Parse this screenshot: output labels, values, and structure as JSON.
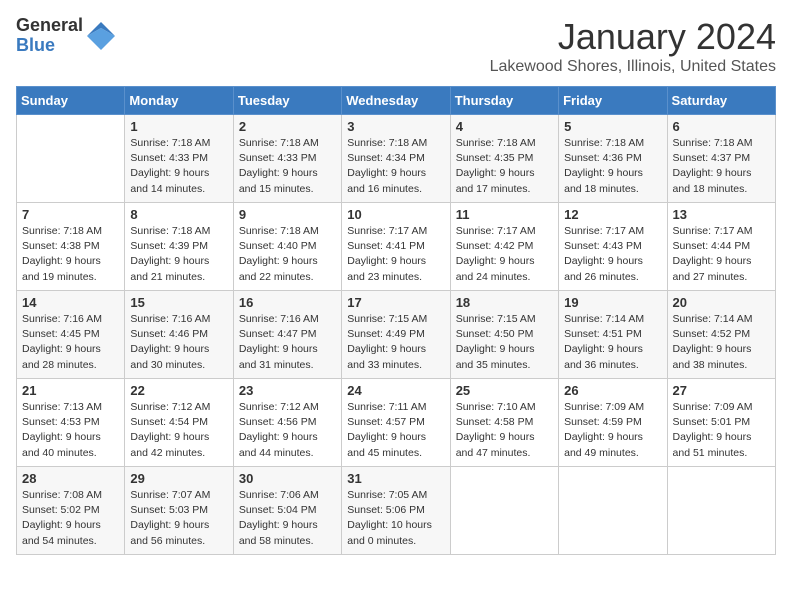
{
  "logo": {
    "general": "General",
    "blue": "Blue"
  },
  "header": {
    "month": "January 2024",
    "location": "Lakewood Shores, Illinois, United States"
  },
  "weekdays": [
    "Sunday",
    "Monday",
    "Tuesday",
    "Wednesday",
    "Thursday",
    "Friday",
    "Saturday"
  ],
  "weeks": [
    [
      {
        "day": "",
        "sunrise": "",
        "sunset": "",
        "daylight": ""
      },
      {
        "day": "1",
        "sunrise": "Sunrise: 7:18 AM",
        "sunset": "Sunset: 4:33 PM",
        "daylight": "Daylight: 9 hours and 14 minutes."
      },
      {
        "day": "2",
        "sunrise": "Sunrise: 7:18 AM",
        "sunset": "Sunset: 4:33 PM",
        "daylight": "Daylight: 9 hours and 15 minutes."
      },
      {
        "day": "3",
        "sunrise": "Sunrise: 7:18 AM",
        "sunset": "Sunset: 4:34 PM",
        "daylight": "Daylight: 9 hours and 16 minutes."
      },
      {
        "day": "4",
        "sunrise": "Sunrise: 7:18 AM",
        "sunset": "Sunset: 4:35 PM",
        "daylight": "Daylight: 9 hours and 17 minutes."
      },
      {
        "day": "5",
        "sunrise": "Sunrise: 7:18 AM",
        "sunset": "Sunset: 4:36 PM",
        "daylight": "Daylight: 9 hours and 18 minutes."
      },
      {
        "day": "6",
        "sunrise": "Sunrise: 7:18 AM",
        "sunset": "Sunset: 4:37 PM",
        "daylight": "Daylight: 9 hours and 18 minutes."
      }
    ],
    [
      {
        "day": "7",
        "sunrise": "Sunrise: 7:18 AM",
        "sunset": "Sunset: 4:38 PM",
        "daylight": "Daylight: 9 hours and 19 minutes."
      },
      {
        "day": "8",
        "sunrise": "Sunrise: 7:18 AM",
        "sunset": "Sunset: 4:39 PM",
        "daylight": "Daylight: 9 hours and 21 minutes."
      },
      {
        "day": "9",
        "sunrise": "Sunrise: 7:18 AM",
        "sunset": "Sunset: 4:40 PM",
        "daylight": "Daylight: 9 hours and 22 minutes."
      },
      {
        "day": "10",
        "sunrise": "Sunrise: 7:17 AM",
        "sunset": "Sunset: 4:41 PM",
        "daylight": "Daylight: 9 hours and 23 minutes."
      },
      {
        "day": "11",
        "sunrise": "Sunrise: 7:17 AM",
        "sunset": "Sunset: 4:42 PM",
        "daylight": "Daylight: 9 hours and 24 minutes."
      },
      {
        "day": "12",
        "sunrise": "Sunrise: 7:17 AM",
        "sunset": "Sunset: 4:43 PM",
        "daylight": "Daylight: 9 hours and 26 minutes."
      },
      {
        "day": "13",
        "sunrise": "Sunrise: 7:17 AM",
        "sunset": "Sunset: 4:44 PM",
        "daylight": "Daylight: 9 hours and 27 minutes."
      }
    ],
    [
      {
        "day": "14",
        "sunrise": "Sunrise: 7:16 AM",
        "sunset": "Sunset: 4:45 PM",
        "daylight": "Daylight: 9 hours and 28 minutes."
      },
      {
        "day": "15",
        "sunrise": "Sunrise: 7:16 AM",
        "sunset": "Sunset: 4:46 PM",
        "daylight": "Daylight: 9 hours and 30 minutes."
      },
      {
        "day": "16",
        "sunrise": "Sunrise: 7:16 AM",
        "sunset": "Sunset: 4:47 PM",
        "daylight": "Daylight: 9 hours and 31 minutes."
      },
      {
        "day": "17",
        "sunrise": "Sunrise: 7:15 AM",
        "sunset": "Sunset: 4:49 PM",
        "daylight": "Daylight: 9 hours and 33 minutes."
      },
      {
        "day": "18",
        "sunrise": "Sunrise: 7:15 AM",
        "sunset": "Sunset: 4:50 PM",
        "daylight": "Daylight: 9 hours and 35 minutes."
      },
      {
        "day": "19",
        "sunrise": "Sunrise: 7:14 AM",
        "sunset": "Sunset: 4:51 PM",
        "daylight": "Daylight: 9 hours and 36 minutes."
      },
      {
        "day": "20",
        "sunrise": "Sunrise: 7:14 AM",
        "sunset": "Sunset: 4:52 PM",
        "daylight": "Daylight: 9 hours and 38 minutes."
      }
    ],
    [
      {
        "day": "21",
        "sunrise": "Sunrise: 7:13 AM",
        "sunset": "Sunset: 4:53 PM",
        "daylight": "Daylight: 9 hours and 40 minutes."
      },
      {
        "day": "22",
        "sunrise": "Sunrise: 7:12 AM",
        "sunset": "Sunset: 4:54 PM",
        "daylight": "Daylight: 9 hours and 42 minutes."
      },
      {
        "day": "23",
        "sunrise": "Sunrise: 7:12 AM",
        "sunset": "Sunset: 4:56 PM",
        "daylight": "Daylight: 9 hours and 44 minutes."
      },
      {
        "day": "24",
        "sunrise": "Sunrise: 7:11 AM",
        "sunset": "Sunset: 4:57 PM",
        "daylight": "Daylight: 9 hours and 45 minutes."
      },
      {
        "day": "25",
        "sunrise": "Sunrise: 7:10 AM",
        "sunset": "Sunset: 4:58 PM",
        "daylight": "Daylight: 9 hours and 47 minutes."
      },
      {
        "day": "26",
        "sunrise": "Sunrise: 7:09 AM",
        "sunset": "Sunset: 4:59 PM",
        "daylight": "Daylight: 9 hours and 49 minutes."
      },
      {
        "day": "27",
        "sunrise": "Sunrise: 7:09 AM",
        "sunset": "Sunset: 5:01 PM",
        "daylight": "Daylight: 9 hours and 51 minutes."
      }
    ],
    [
      {
        "day": "28",
        "sunrise": "Sunrise: 7:08 AM",
        "sunset": "Sunset: 5:02 PM",
        "daylight": "Daylight: 9 hours and 54 minutes."
      },
      {
        "day": "29",
        "sunrise": "Sunrise: 7:07 AM",
        "sunset": "Sunset: 5:03 PM",
        "daylight": "Daylight: 9 hours and 56 minutes."
      },
      {
        "day": "30",
        "sunrise": "Sunrise: 7:06 AM",
        "sunset": "Sunset: 5:04 PM",
        "daylight": "Daylight: 9 hours and 58 minutes."
      },
      {
        "day": "31",
        "sunrise": "Sunrise: 7:05 AM",
        "sunset": "Sunset: 5:06 PM",
        "daylight": "Daylight: 10 hours and 0 minutes."
      },
      {
        "day": "",
        "sunrise": "",
        "sunset": "",
        "daylight": ""
      },
      {
        "day": "",
        "sunrise": "",
        "sunset": "",
        "daylight": ""
      },
      {
        "day": "",
        "sunrise": "",
        "sunset": "",
        "daylight": ""
      }
    ]
  ]
}
